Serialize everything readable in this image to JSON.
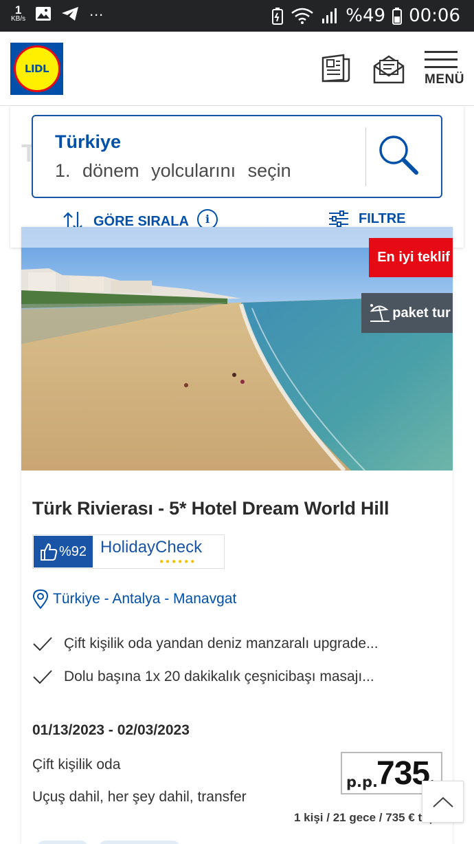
{
  "status_bar": {
    "speed_value": "1",
    "speed_unit": "KB/s",
    "dots": "…",
    "battery_percent": "%49",
    "time": "00:06"
  },
  "header": {
    "logo_text": "LIDL",
    "menu_label": "MENÜ"
  },
  "search": {
    "destination": "Türkiye",
    "period": "1. dönem",
    "travelers_prompt": "yolcularını seçin"
  },
  "toolbar": {
    "sort_label": "GÖRE SIRALA",
    "filter_label": "FILTRE"
  },
  "offer": {
    "badge_best": "En iyi teklif",
    "badge_package": "paket tur",
    "title": "Türk Rivierası - 5* Hotel Dream World Hill",
    "rating": {
      "score": "%92",
      "provider": "HolidayCheck"
    },
    "location": "Türkiye - Antalya - Manavgat",
    "features": [
      "Çift kişilik oda yandan deniz manzaralı upgrade...",
      "Dolu başına 1x 20 dakikalık çeşnicibaşı masajı..."
    ],
    "dates": "01/13/2023 - 02/03/2023",
    "room": "Çift kişilik oda",
    "inclusions": "Uçuş dahil, her şey dahil, transfer",
    "price_prefix": "p.p.",
    "price": "735",
    "price_note": "1 kişi / 21 gece / 735 € top"
  },
  "colors": {
    "brand_blue": "#0050aa",
    "brand_red": "#e60a14",
    "brand_yellow": "#fff000",
    "package_badge": "#4b5560"
  }
}
